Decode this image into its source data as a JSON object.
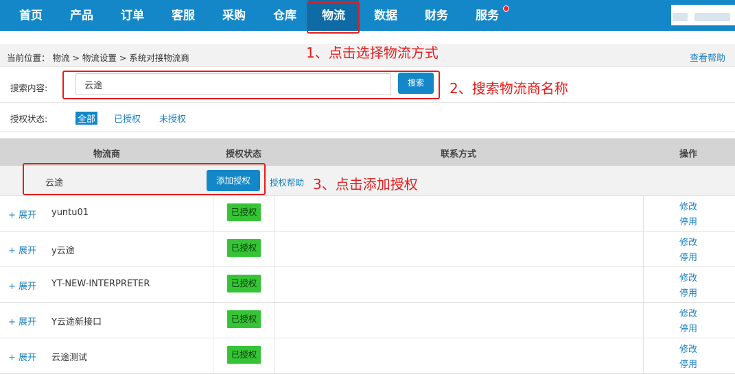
{
  "nav": {
    "items": [
      "首页",
      "产品",
      "订单",
      "客服",
      "采购",
      "仓库",
      "物流",
      "数据",
      "财务",
      "服务"
    ],
    "active": "物流"
  },
  "breadcrumb": {
    "text": "当前位置： 物流 > 物流设置 > 系统对接物流商",
    "help": "查看帮助"
  },
  "search": {
    "label": "搜索内容:",
    "value": "云途",
    "button": "搜索"
  },
  "auth_filter": {
    "label": "授权状态:",
    "options": [
      "全部",
      "已授权",
      "未授权"
    ],
    "selected": "全部"
  },
  "table": {
    "headers": [
      "物流商",
      "授权状态",
      "联系方式",
      "操作"
    ],
    "group": {
      "name": "云途",
      "add_button": "添加授权",
      "help": "授权帮助"
    },
    "rows": [
      {
        "expand": "+ 展开",
        "name": "yuntu01",
        "status": "已授权",
        "edit": "修改",
        "disable": "停用"
      },
      {
        "expand": "+ 展开",
        "name": "y云途",
        "status": "已授权",
        "edit": "修改",
        "disable": "停用"
      },
      {
        "expand": "+ 展开",
        "name": "YT-NEW-INTERPRETER",
        "status": "已授权",
        "edit": "修改",
        "disable": "停用"
      },
      {
        "expand": "+ 展开",
        "name": "Y云途新接口",
        "status": "已授权",
        "edit": "修改",
        "disable": "停用"
      },
      {
        "expand": "+ 展开",
        "name": "云途测试",
        "status": "已授权",
        "edit": "修改",
        "disable": "停用"
      }
    ]
  },
  "annotations": {
    "step1": "1、点击选择物流方式",
    "step2": "2、搜索物流商名称",
    "step3": "3、点击添加授权"
  },
  "colors": {
    "nav_bg": "#1487c8",
    "nav_active": "#0e6ba6",
    "link": "#1a7fc1",
    "status_green": "#36c436",
    "annotation_red": "#e81b1b"
  }
}
